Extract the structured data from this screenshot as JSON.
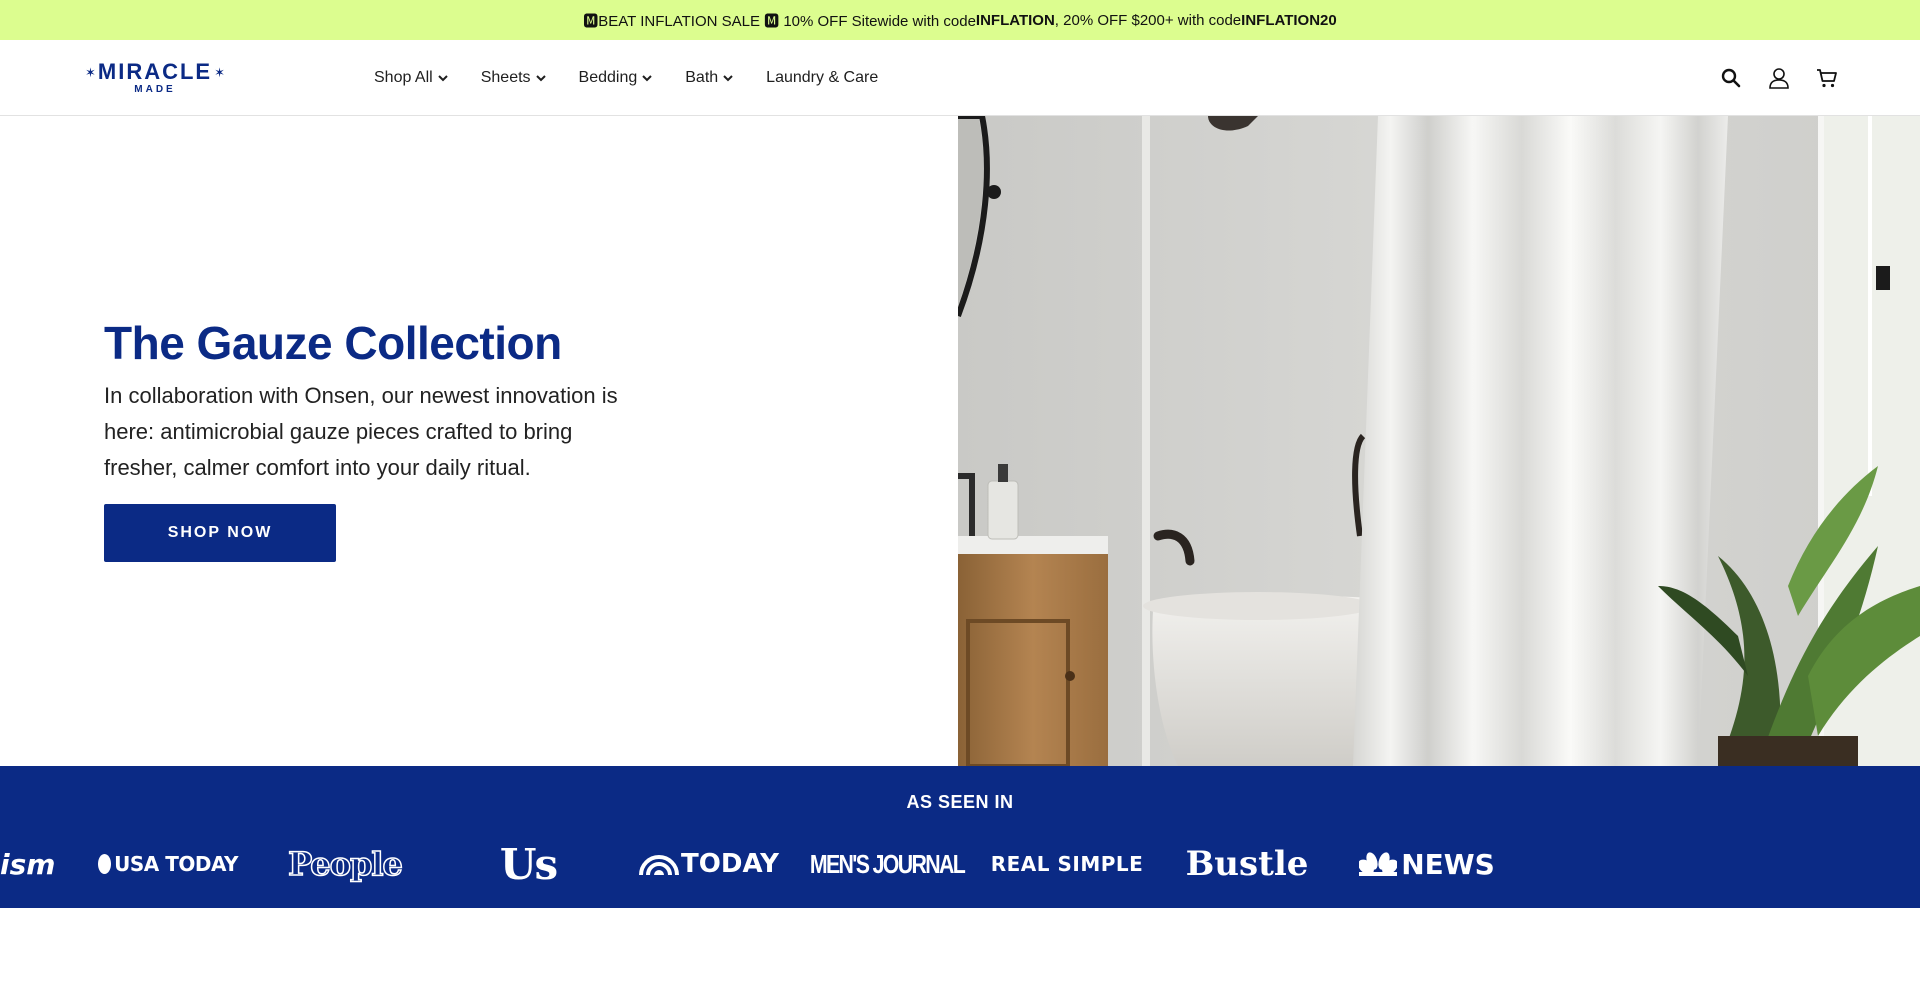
{
  "promo": {
    "part1": "🅼BEAT INFLATION SALE 🅼 10% OFF Sitewide with code ",
    "code1": "INFLATION",
    "part2": ", 20% OFF $200+ with code ",
    "code2": "INFLATION20"
  },
  "logo": {
    "word": "MIRACLE",
    "sub": "MADE"
  },
  "nav": {
    "items": [
      {
        "label": "Shop All",
        "has_dropdown": true
      },
      {
        "label": "Sheets",
        "has_dropdown": true
      },
      {
        "label": "Bedding",
        "has_dropdown": true
      },
      {
        "label": "Bath",
        "has_dropdown": true
      },
      {
        "label": "Laundry & Care",
        "has_dropdown": false
      }
    ]
  },
  "header_icons": [
    "search-icon",
    "account-icon",
    "cart-icon"
  ],
  "hero": {
    "title": "The Gauze Collection",
    "description": "In collaboration with Onsen, our newest innovation is here: antimicrobial gauze pieces crafted to bring fresher, calmer comfort into your daily ritual.",
    "cta": "SHOP NOW"
  },
  "press": {
    "title": "AS SEEN IN",
    "logos": [
      "ism",
      "USA TODAY",
      "People",
      "Us",
      "TODAY",
      "MEN'S JOURNAL",
      "REAL SIMPLE",
      "Bustle",
      "NEWS"
    ]
  },
  "colors": {
    "promo_bg": "#dcfd8f",
    "brand_navy": "#0b2a85",
    "text": "#1a1a1a"
  }
}
